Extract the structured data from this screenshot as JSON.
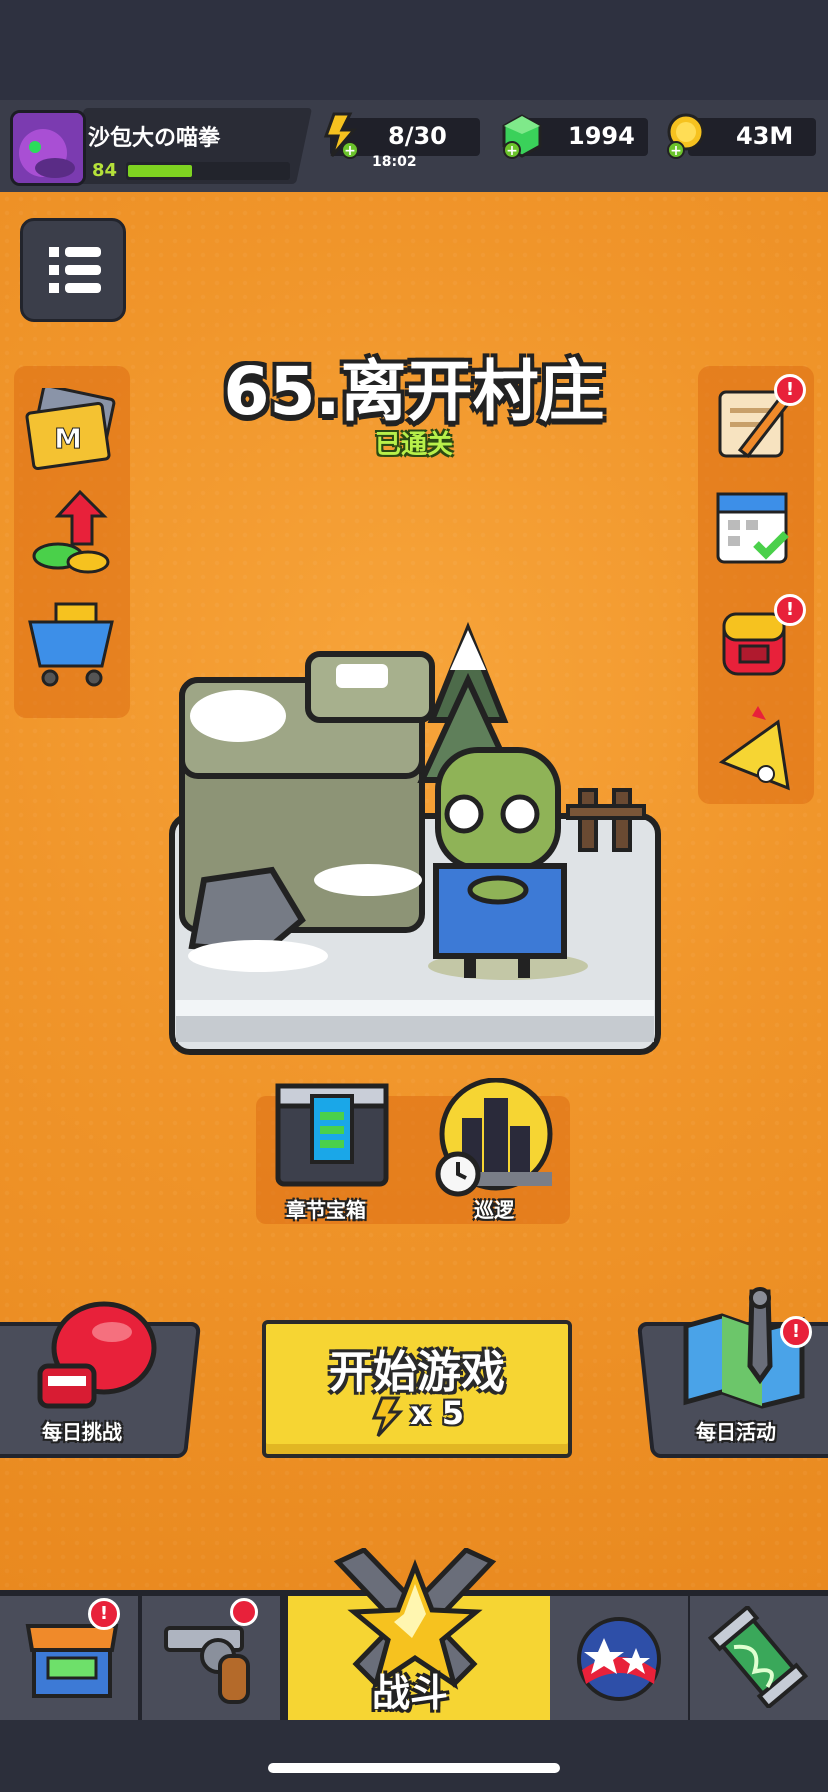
{
  "player": {
    "name": "沙包大の喵拳",
    "level": "84",
    "xp_fraction": 0.4
  },
  "resources": {
    "energy": "8/30",
    "energy_timer": "18:02",
    "gems": "1994",
    "coins": "43M"
  },
  "stage": {
    "title": "65.离开村庄",
    "status": "已通关"
  },
  "chapter": {
    "chest_label": "章节宝箱",
    "patrol_label": "巡逻"
  },
  "actions": {
    "daily_challenge": "每日挑战",
    "start_game": "开始游戏",
    "start_cost": "x 5",
    "daily_activity": "每日活动"
  },
  "badges": {
    "exclaim": "!"
  },
  "nav": {
    "battle_label": "战斗"
  },
  "colors": {
    "background": "#f0952a",
    "accent_yellow": "#f6d533",
    "hud_dark": "#3a3d4a",
    "alert_red": "#e8213a"
  }
}
